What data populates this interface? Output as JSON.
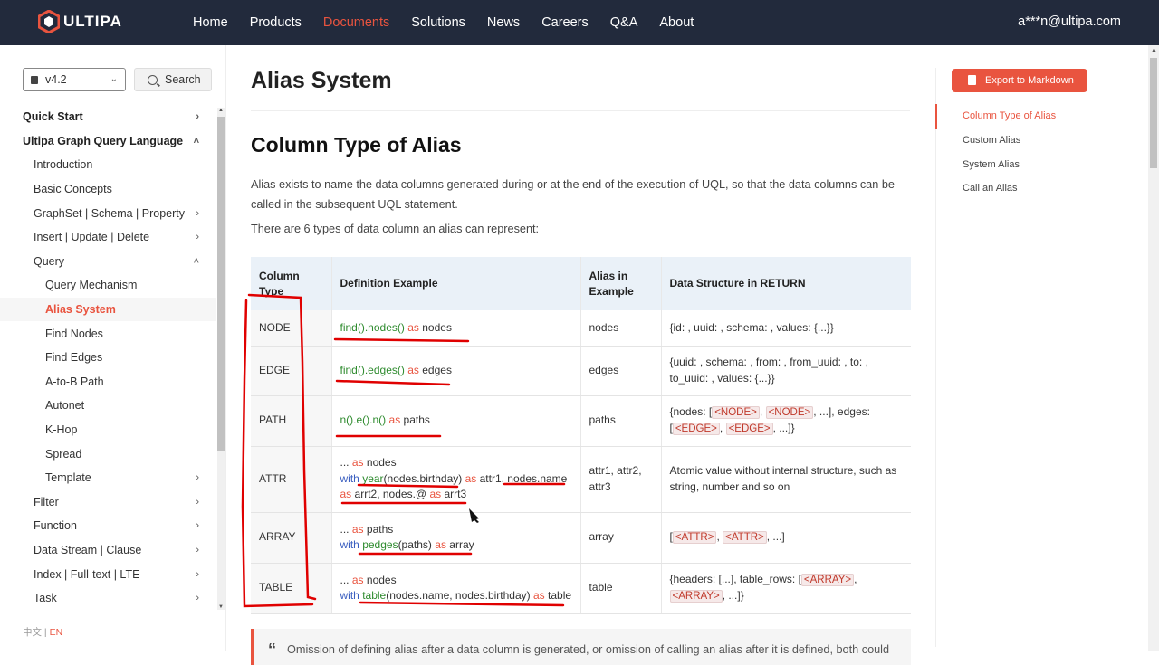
{
  "nav": {
    "logo_text": "ULTIPA",
    "links": [
      "Home",
      "Products",
      "Documents",
      "Solutions",
      "News",
      "Careers",
      "Q&A",
      "About"
    ],
    "user_email": "a***n@ultipa.com"
  },
  "sidebar": {
    "version": "v4.2",
    "search_label": "Search",
    "items": [
      {
        "label": "Quick Start",
        "level": 0,
        "arrow": "›"
      },
      {
        "label": "Ultipa Graph Query Language",
        "level": 0,
        "arrow": "˄"
      },
      {
        "label": "Introduction",
        "level": 1,
        "arrow": ""
      },
      {
        "label": "Basic Concepts",
        "level": 1,
        "arrow": ""
      },
      {
        "label": "GraphSet | Schema | Property",
        "level": 1,
        "arrow": "›"
      },
      {
        "label": "Insert | Update | Delete",
        "level": 1,
        "arrow": "›"
      },
      {
        "label": "Query",
        "level": 1,
        "arrow": "˄"
      },
      {
        "label": "Query Mechanism",
        "level": 2,
        "arrow": ""
      },
      {
        "label": "Alias System",
        "level": 2,
        "arrow": "",
        "active": true
      },
      {
        "label": "Find Nodes",
        "level": 2,
        "arrow": ""
      },
      {
        "label": "Find Edges",
        "level": 2,
        "arrow": ""
      },
      {
        "label": "A-to-B Path",
        "level": 2,
        "arrow": ""
      },
      {
        "label": "Autonet",
        "level": 2,
        "arrow": ""
      },
      {
        "label": "K-Hop",
        "level": 2,
        "arrow": ""
      },
      {
        "label": "Spread",
        "level": 2,
        "arrow": ""
      },
      {
        "label": "Template",
        "level": 2,
        "arrow": "›"
      },
      {
        "label": "Filter",
        "level": 1,
        "arrow": "›"
      },
      {
        "label": "Function",
        "level": 1,
        "arrow": "›"
      },
      {
        "label": "Data Stream | Clause",
        "level": 1,
        "arrow": "›"
      },
      {
        "label": "Index | Full-text | LTE",
        "level": 1,
        "arrow": "›"
      },
      {
        "label": "Task",
        "level": 1,
        "arrow": "›"
      }
    ],
    "lang_zh": "中文",
    "lang_sep": "|",
    "lang_en": "EN"
  },
  "main": {
    "page_title": "Alias System",
    "section_title": "Column Type of Alias",
    "para1": "Alias exists to name the data columns generated during or at the end of the execution of UQL, so that the data columns can be called in the subsequent UQL statement.",
    "para2": "There are 6 types of data column an alias can represent:",
    "table": {
      "headers": [
        "Column Type",
        "Definition Example",
        "Alias in Example",
        "Data Structure in RETURN"
      ],
      "rows": [
        {
          "type": "NODE",
          "alias": "nodes",
          "structure": "{id: , uuid: , schema: , values: {...}}"
        },
        {
          "type": "EDGE",
          "alias": "edges",
          "structure": "{uuid: , schema: , from: , from_uuid: , to: , to_uuid: , values: {...}}"
        },
        {
          "type": "PATH",
          "alias": "paths",
          "structure_a": "{nodes: [",
          "tag1": "<NODE>",
          "sep1": ",",
          "tag2": "<NODE>",
          "structure_b": ", ...], edges: [",
          "tag3": "<EDGE>",
          "sep2": ",",
          "tag4": "<EDGE>",
          "structure_c": ", ...]}"
        },
        {
          "type": "ATTR",
          "alias": "attr1, attr2, attr3",
          "structure": "Atomic value without internal structure, such as string, number and so on"
        },
        {
          "type": "ARRAY",
          "alias": "array",
          "structure_a": "[",
          "tag1": "<ATTR>",
          "sep1": ",",
          "tag2": "<ATTR>",
          "structure_b": ", ...]"
        },
        {
          "type": "TABLE",
          "alias": "table",
          "structure_a": "{headers: [...], table_rows: [",
          "tag1": "<ARRAY>",
          "sep1": ",",
          "tag2": "<ARRAY>",
          "structure_b": ", ...]}"
        }
      ],
      "code": {
        "node": {
          "fn": "find().nodes()",
          "kw": "as",
          "alias": "nodes"
        },
        "edge": {
          "fn": "find().edges()",
          "kw": "as",
          "alias": "edges"
        },
        "path": {
          "fn": "n().e().n()",
          "kw": "as",
          "alias": "paths"
        },
        "attr": {
          "l1_pre": "...",
          "l1_kw": "as",
          "l1_alias": "nodes",
          "l2_with": "with",
          "l2_fn": "year",
          "l2_arg": "(nodes.birthday)",
          "l2_kw": "as",
          "l2_rest": "attr1, nodes.name",
          "l3_kw1": "as",
          "l3_mid": "arrt2, nodes.@",
          "l3_kw2": "as",
          "l3_alias": "arrt3"
        },
        "array": {
          "l1_pre": "...",
          "l1_kw": "as",
          "l1_alias": "paths",
          "l2_with": "with",
          "l2_fn": "pedges",
          "l2_arg": "(paths)",
          "l2_kw": "as",
          "l2_alias": "array"
        },
        "table": {
          "l1_pre": "...",
          "l1_kw": "as",
          "l1_alias": "nodes",
          "l2_with": "with",
          "l2_fn": "table",
          "l2_arg": "(nodes.name, nodes.birthday)",
          "l2_kw": "as",
          "l2_alias": "table"
        }
      }
    },
    "quote_mark": "“",
    "quote_text": "Omission of defining alias after a data column is generated, or omission of calling an alias after it is defined, both could"
  },
  "toc": {
    "export_label": "Export to Markdown",
    "items": [
      "Column Type of Alias",
      "Custom Alias",
      "System Alias",
      "Call an Alias"
    ]
  },
  "colors": {
    "accent": "#e9543f",
    "nav_bg": "#222a3c",
    "annotation": "#e00000"
  }
}
